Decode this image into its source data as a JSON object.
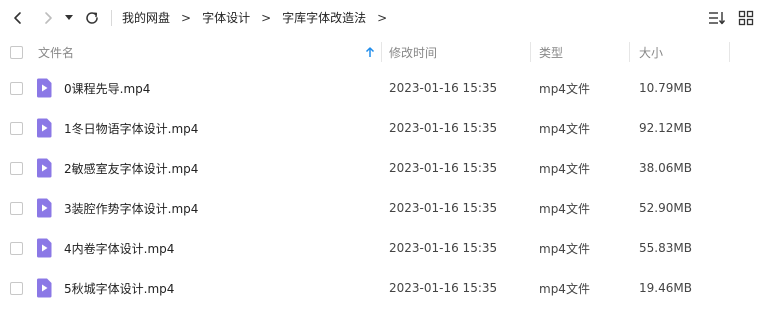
{
  "breadcrumb": {
    "items": [
      "我的网盘",
      "字体设计",
      "字库字体改造法"
    ],
    "separator": ">"
  },
  "table": {
    "columns": {
      "name": "文件名",
      "modified": "修改时间",
      "type": "类型",
      "size": "大小"
    },
    "sort": {
      "column": "name",
      "direction": "ascending"
    },
    "rows": [
      {
        "name": "0课程先导.mp4",
        "modified": "2023-01-16 15:35",
        "type": "mp4文件",
        "size": "10.79MB"
      },
      {
        "name": "1冬日物语字体设计.mp4",
        "modified": "2023-01-16 15:35",
        "type": "mp4文件",
        "size": "92.12MB"
      },
      {
        "name": "2敏感室友字体设计.mp4",
        "modified": "2023-01-16 15:35",
        "type": "mp4文件",
        "size": "38.06MB"
      },
      {
        "name": "3装腔作势字体设计.mp4",
        "modified": "2023-01-16 15:35",
        "type": "mp4文件",
        "size": "52.90MB"
      },
      {
        "name": "4内卷字体设计.mp4",
        "modified": "2023-01-16 15:35",
        "type": "mp4文件",
        "size": "55.83MB"
      },
      {
        "name": "5秋城字体设计.mp4",
        "modified": "2023-01-16 15:35",
        "type": "mp4文件",
        "size": "19.46MB"
      }
    ]
  },
  "icons": {
    "back": "chevron-left-icon",
    "forward": "chevron-right-icon",
    "history": "caret-down-icon",
    "refresh": "refresh-icon",
    "sort": "sort-list-icon",
    "grid": "grid-view-icon",
    "file": "video-file-icon"
  },
  "colors": {
    "file_icon": "#8b78e6",
    "sort_arrow": "#1f8ceb"
  }
}
